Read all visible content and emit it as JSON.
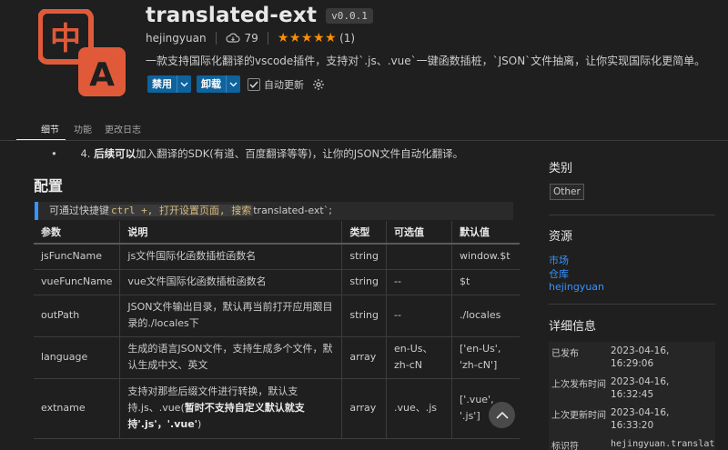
{
  "extension": {
    "name": "translated-ext",
    "version": "v0.0.1",
    "publisher": "hejingyuan",
    "installs": "79",
    "stars": "★★★★★",
    "rating_count": "(1)",
    "description": "一款支持国际化翻译的vscode插件，支持对`.js、.vue`一键函数插桩，`JSON`文件抽离，让你实现国际化更简单。",
    "logo_top_char": "中",
    "logo_bottom_char": "A"
  },
  "actions": {
    "disable_label": "禁用",
    "uninstall_label": "卸载",
    "auto_update_label": "自动更新",
    "auto_update_checked": true
  },
  "tabs": [
    {
      "label": "细节",
      "active": true
    },
    {
      "label": "功能",
      "active": false
    },
    {
      "label": "更改日志",
      "active": false
    }
  ],
  "content": {
    "bullet_dot": "•",
    "bullet_number": "4.",
    "bullet_bold": "后续可以",
    "bullet_rest": "加入翻译的SDK(有道、百度翻译等等)，让你的JSON文件自动化翻译。",
    "section_title": "配置",
    "quote_prefix": "可通过快捷键",
    "quote_code": "ctrl +, 打开设置页面, 搜索",
    "quote_suffix": "translated-ext`;",
    "table": {
      "headers": [
        "参数",
        "说明",
        "类型",
        "可选值",
        "默认值"
      ],
      "rows": [
        {
          "param": "jsFuncName",
          "desc": "js文件国际化函数插桩函数名",
          "type": "string",
          "options": "",
          "default": "window.$t"
        },
        {
          "param": "vueFuncName",
          "desc": "vue文件国际化函数插桩函数名",
          "type": "string",
          "options": "--",
          "default": "$t"
        },
        {
          "param": "outPath",
          "desc": "JSON文件输出目录，默认再当前打开应用跟目录的./locales下",
          "type": "string",
          "options": "--",
          "default": "./locales"
        },
        {
          "param": "language",
          "desc": "生成的语言JSON文件，支持生成多个文件，默认生成中文、英文",
          "type": "array",
          "options": "en-Us、zh-cN",
          "default": "['en-Us', 'zh-cN']"
        },
        {
          "param": "extname",
          "desc_plain": "支持对那些后缀文件进行转换，默认支持.js、.vue(",
          "desc_bold": "暂时不支持自定义默认就支持'.js'，'.vue'",
          "desc_end": ")",
          "type": "array",
          "options": ".vue、.js",
          "default": "['.vue', '.js']"
        }
      ]
    }
  },
  "sidebar": {
    "category_title": "类别",
    "category_tag": "Other",
    "resources_title": "资源",
    "resources": [
      "市场",
      "仓库",
      "hejingyuan"
    ],
    "details_title": "详细信息",
    "details": [
      {
        "key": "已发布",
        "value_line1": "2023-04-16,",
        "value_line2": "16:29:06"
      },
      {
        "key": "上次发布时间",
        "value_line1": "2023-04-16,",
        "value_line2": "16:32:45"
      },
      {
        "key": "上次更新时间",
        "value_line1": "2023-04-16,",
        "value_line2": "16:33:20"
      },
      {
        "key": "标识符",
        "value_line1": "hejingyuan.translate"
      }
    ]
  },
  "colors": {
    "logo": "#e05a3a",
    "link": "#3794ff",
    "button": "#0e639c",
    "stars": "#ff8e00"
  }
}
